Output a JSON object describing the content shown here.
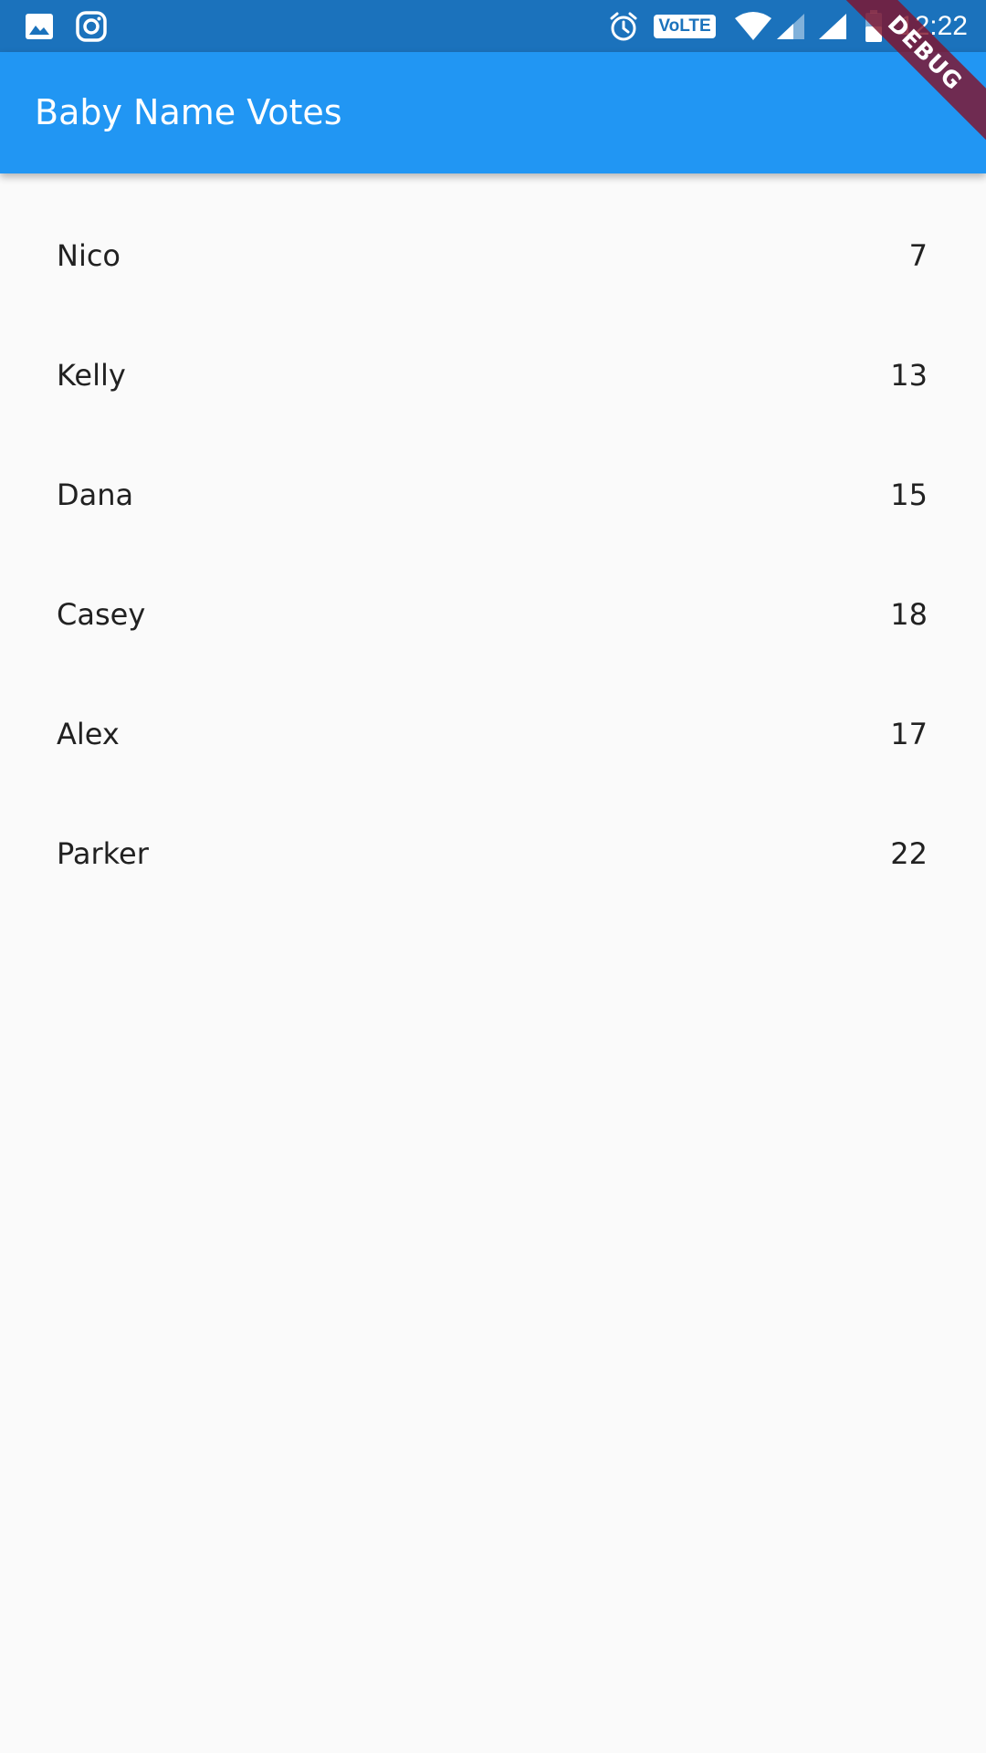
{
  "status_bar": {
    "time": "12:22",
    "volte": "VoLTE",
    "left_icons": [
      "image-icon",
      "instagram-icon"
    ],
    "right_icons": [
      "alarm-icon",
      "volte-icon",
      "wifi-icon",
      "signal-icon",
      "signal-full-icon",
      "battery-icon"
    ],
    "background": "#1b72bc"
  },
  "app_bar": {
    "title": "Baby Name Votes",
    "background": "#2196f3"
  },
  "debug_banner": {
    "label": "DEBUG"
  },
  "list": {
    "items": [
      {
        "name": "Nico",
        "votes": "7"
      },
      {
        "name": "Kelly",
        "votes": "13"
      },
      {
        "name": "Dana",
        "votes": "15"
      },
      {
        "name": "Casey",
        "votes": "18"
      },
      {
        "name": "Alex",
        "votes": "17"
      },
      {
        "name": "Parker",
        "votes": "22"
      }
    ]
  }
}
